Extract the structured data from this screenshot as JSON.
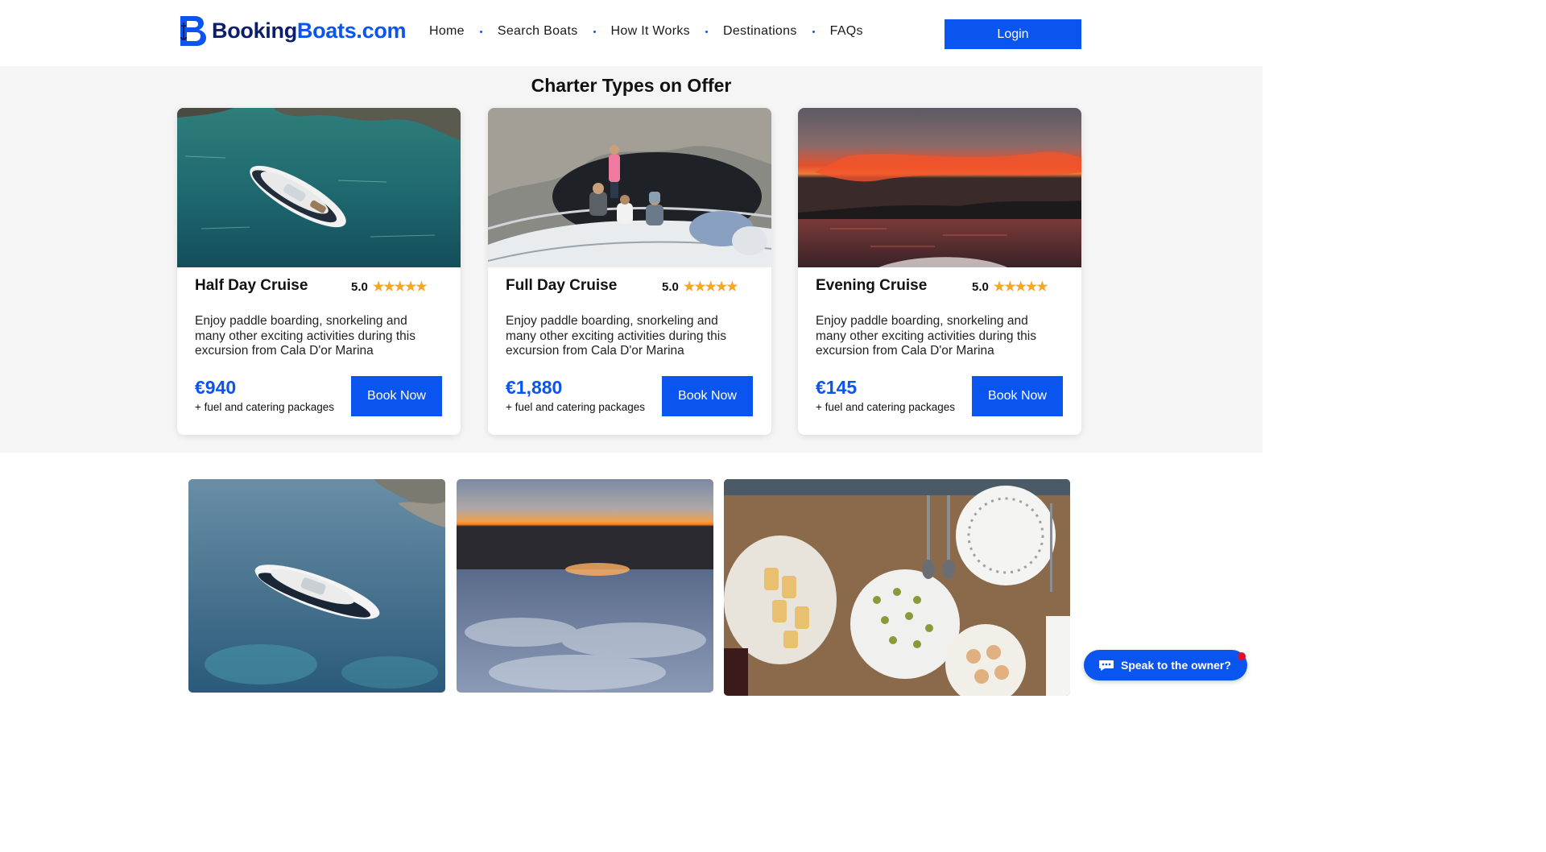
{
  "header": {
    "logo_part1": "Booking",
    "logo_part2": "Boats.com",
    "nav": [
      "Home",
      "Search Boats",
      "How It Works",
      "Destinations",
      "FAQs"
    ],
    "login_label": "Login"
  },
  "charters": {
    "title": "Charter Types on Offer",
    "cards": [
      {
        "name": "Half Day Cruise",
        "rating": "5.0",
        "stars": "★★★★★",
        "description": "Enjoy paddle boarding, snorkeling and many other exciting activities during this excursion from Cala D'or Marina",
        "price": "€940",
        "price_note": "+ fuel and catering packages",
        "button": "Book Now"
      },
      {
        "name": "Full Day Cruise",
        "rating": "5.0",
        "stars": "★★★★★",
        "description": "Enjoy paddle boarding, snorkeling and many other exciting activities during this excursion from Cala D'or Marina",
        "price": "€1,880",
        "price_note": "+ fuel and catering packages",
        "button": "Book Now"
      },
      {
        "name": "Evening Cruise",
        "rating": "5.0",
        "stars": "★★★★★",
        "description": "Enjoy paddle boarding, snorkeling and many other exciting activities during this excursion from Cala D'or Marina",
        "price": "€145",
        "price_note": "+ fuel and catering packages",
        "button": "Book Now"
      }
    ]
  },
  "chat": {
    "label": "Speak to the owner?"
  },
  "colors": {
    "brand": "#0a55f0",
    "brand_dark": "#0a1e6b",
    "star": "#f5a623",
    "section_bg": "#f5f5f5"
  }
}
